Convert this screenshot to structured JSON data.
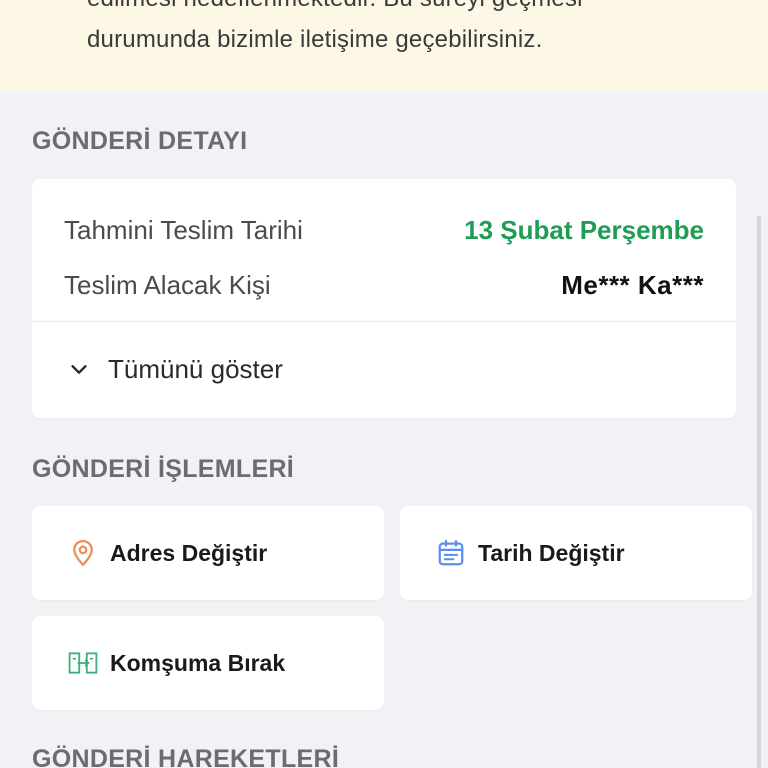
{
  "notice": {
    "line1": "edilmesi hedeflenmektedir. Bu süreyi geçmesi",
    "line2": "durumunda bizimle iletişime geçebilirsiniz."
  },
  "shipment_detail": {
    "title": "GÖNDERİ DETAYI",
    "estimated_delivery_label": "Tahmini Teslim Tarihi",
    "estimated_delivery_value": "13 Şubat Perşembe",
    "recipient_label": "Teslim Alacak Kişi",
    "recipient_value": "Me*** Ka***",
    "show_all_label": "Tümünü göster"
  },
  "shipment_actions": {
    "title": "GÖNDERİ İŞLEMLERİ",
    "change_address": "Adres Değiştir",
    "change_date": "Tarih Değiştir",
    "leave_with_neighbor": "Komşuma Bırak"
  },
  "shipment_movements": {
    "title": "GÖNDERİ HAREKETLERİ"
  },
  "colors": {
    "accent_green": "#1f9d55",
    "pin_orange": "#ef8d5a",
    "calendar_blue": "#5b8def",
    "neighbor_green": "#3fae7a"
  },
  "icons": [
    "chevron-down-icon",
    "location-pin-icon",
    "calendar-icon",
    "neighbor-transfer-icon"
  ]
}
